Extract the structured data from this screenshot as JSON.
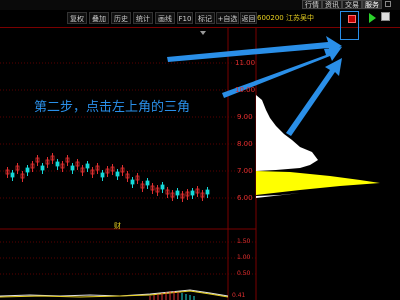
{
  "top_tabs": [
    {
      "label": "行情",
      "active": false
    },
    {
      "label": "资讯",
      "active": false
    },
    {
      "label": "交易",
      "active": false
    },
    {
      "label": "服务",
      "active": true
    }
  ],
  "toolbar_buttons": [
    "复权",
    "叠加",
    "历史",
    "统计",
    "画线",
    "F10",
    "标记",
    "+自选",
    "返回"
  ],
  "stock_label": "600200 江苏吴中",
  "price_axis": [
    "11.00",
    "10.00",
    "9.00",
    "8.00",
    "7.00",
    "6.00"
  ],
  "volume_axis": [
    "1.50",
    "1.00",
    "0.50"
  ],
  "volume_axis_partial": "0.41",
  "caption_marker": "财",
  "annotation": "第二步，点击左上角的三角",
  "colors": {
    "up": "#e03030",
    "down": "#17d8d8",
    "accent_arrow": "#2a8fe8",
    "stock_label": "#e8d020",
    "grid": "#5a0000"
  },
  "icons": [
    "red-triangle-icon",
    "green-play-icon",
    "info-icon",
    "dropdown-icon"
  ]
}
